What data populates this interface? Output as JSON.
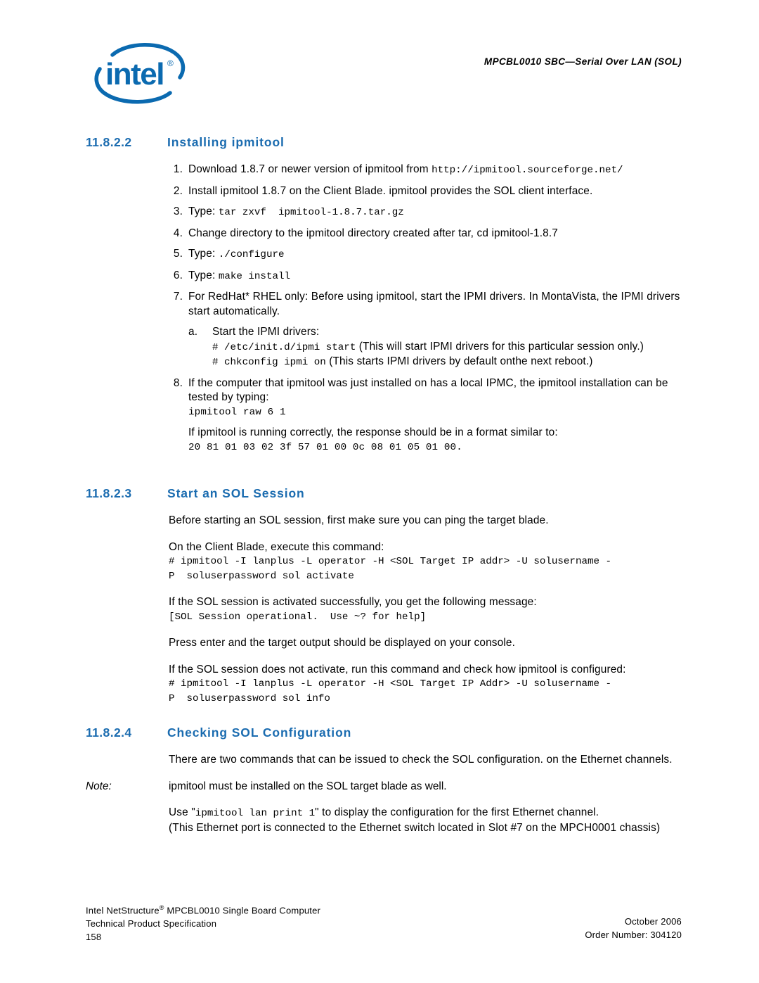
{
  "header": {
    "logo_alt": "intel-logo",
    "logo_wordmark": "intel",
    "logo_registered": "®",
    "title": "MPCBL0010 SBC—Serial Over LAN (SOL)",
    "brand_color": "#0b6ab0"
  },
  "accent_color": "#1b6cb0",
  "sections": [
    {
      "number": "11.8.2.2",
      "title": "Installing ipmitool",
      "items": [
        {
          "marker": "1.",
          "text": "Download 1.8.7 or newer version of ipmitool from ",
          "mono_tail": "http://ipmitool.sourceforge.net/"
        },
        {
          "marker": "2.",
          "text": "Install ipmitool 1.8.7 on the Client Blade.  ipmitool provides the SOL client interface."
        },
        {
          "marker": "3.",
          "text": "Type: ",
          "mono_tail": "tar zxvf  ipmitool-1.8.7.tar.gz"
        },
        {
          "marker": "4.",
          "text": "Change directory to the ipmitool directory created after tar, cd ipmitool-1.8.7"
        },
        {
          "marker": "5.",
          "text": "Type: ",
          "mono_tail": "./configure"
        },
        {
          "marker": "6.",
          "text": "Type: ",
          "mono_tail": "make install"
        },
        {
          "marker": "7.",
          "text": "For RedHat* RHEL only:  Before using ipmitool, start the IPMI drivers. In MontaVista, the IPMI drivers start automatically."
        }
      ],
      "sub_item": {
        "marker": "a.",
        "text": "Start the IPMI drivers:",
        "cmd_1_mono": "# /etc/init.d/ipmi start",
        "cmd_1_note": " (This will start IPMI drivers for this particular session only.)",
        "cmd_2_mono": "# chkconfig ipmi on",
        "cmd_2_note": " (This starts IPMI drivers by default onthe next reboot.)"
      },
      "item_8": {
        "marker": "8.",
        "text": "If the computer that ipmitool was just installed on has a local IPMC, the ipmitool installation can be tested by typing:",
        "command": "ipmitool raw 6 1",
        "response_intro": "If ipmitool is running correctly, the response should be in a format similar to:",
        "response": "20 81 01 03 02 3f 57 01 00 0c 08 01 05 01 00."
      }
    },
    {
      "number": "11.8.2.3",
      "title": "Start an SOL Session",
      "para_1": "Before starting an SOL session, first make sure you can ping the target blade.",
      "para_2": "On the Client Blade, execute this command:",
      "command_1": "# ipmitool -I lanplus -L operator -H <SOL Target IP addr> -U solusername -\nP  soluserpassword sol activate",
      "para_3": "If the SOL session is activated successfully, you get the following message:",
      "message": "[SOL Session operational.  Use ~? for help]",
      "para_4": "Press enter and the target output should be displayed on your console.",
      "para_5": "If the SOL session does not activate, run this command and check how ipmitool is configured:",
      "command_2": "# ipmitool -I lanplus -L operator -H <SOL Target IP Addr> -U solusername -\nP  soluserpassword sol info"
    },
    {
      "number": "11.8.2.4",
      "title": "Checking SOL Configuration",
      "para_1": "There are two commands that can be issued to check the SOL configuration. on the Ethernet channels.",
      "note_label": "Note:",
      "note_text": "ipmitool must be installed on the SOL target blade as well.",
      "use_prefix": "Use \"",
      "use_mono": "ipmitool lan print 1",
      "use_suffix": "\" to display the configuration for the first Ethernet channel.",
      "para_2": "(This Ethernet port is connected to the Ethernet switch located in Slot #7 on the MPCH0001 chassis)"
    }
  ],
  "footer": {
    "product_line_prefix": "Intel NetStructure",
    "product_line_reg": "®",
    "product_line_suffix": " MPCBL0010 Single Board Computer",
    "doc_type": "Technical Product Specification",
    "page_number": "158",
    "date": "October 2006",
    "order_number": "Order Number: 304120"
  }
}
